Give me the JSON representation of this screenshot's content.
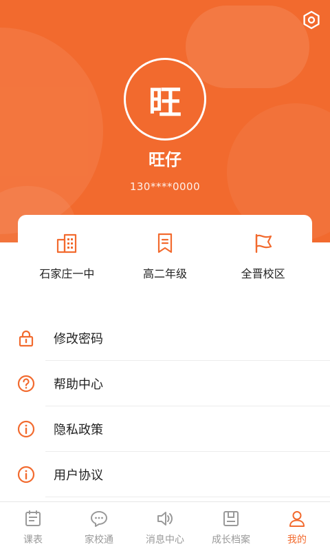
{
  "colors": {
    "accent": "#f26a2e",
    "inactive": "#999999",
    "text": "#222222"
  },
  "profile": {
    "avatar_char": "旺",
    "name": "旺仔",
    "phone": "130****0000"
  },
  "settings_icon": "settings-hexagon-icon",
  "info": [
    {
      "icon": "building-icon",
      "label": "石家庄一中"
    },
    {
      "icon": "bookmark-icon",
      "label": "高二年级"
    },
    {
      "icon": "flag-icon",
      "label": "全晋校区"
    }
  ],
  "menu": [
    {
      "icon": "lock-icon",
      "label": "修改密码"
    },
    {
      "icon": "question-circle-icon",
      "label": "帮助中心"
    },
    {
      "icon": "info-circle-icon",
      "label": "隐私政策"
    },
    {
      "icon": "info-circle-icon",
      "label": "用户协议"
    }
  ],
  "tabs": [
    {
      "icon": "timetable-icon",
      "label": "课表"
    },
    {
      "icon": "chat-bubble-icon",
      "label": "家校通"
    },
    {
      "icon": "speaker-icon",
      "label": "消息中心"
    },
    {
      "icon": "archive-icon",
      "label": "成长档案"
    },
    {
      "icon": "user-icon",
      "label": "我的"
    }
  ],
  "active_tab": "我的"
}
